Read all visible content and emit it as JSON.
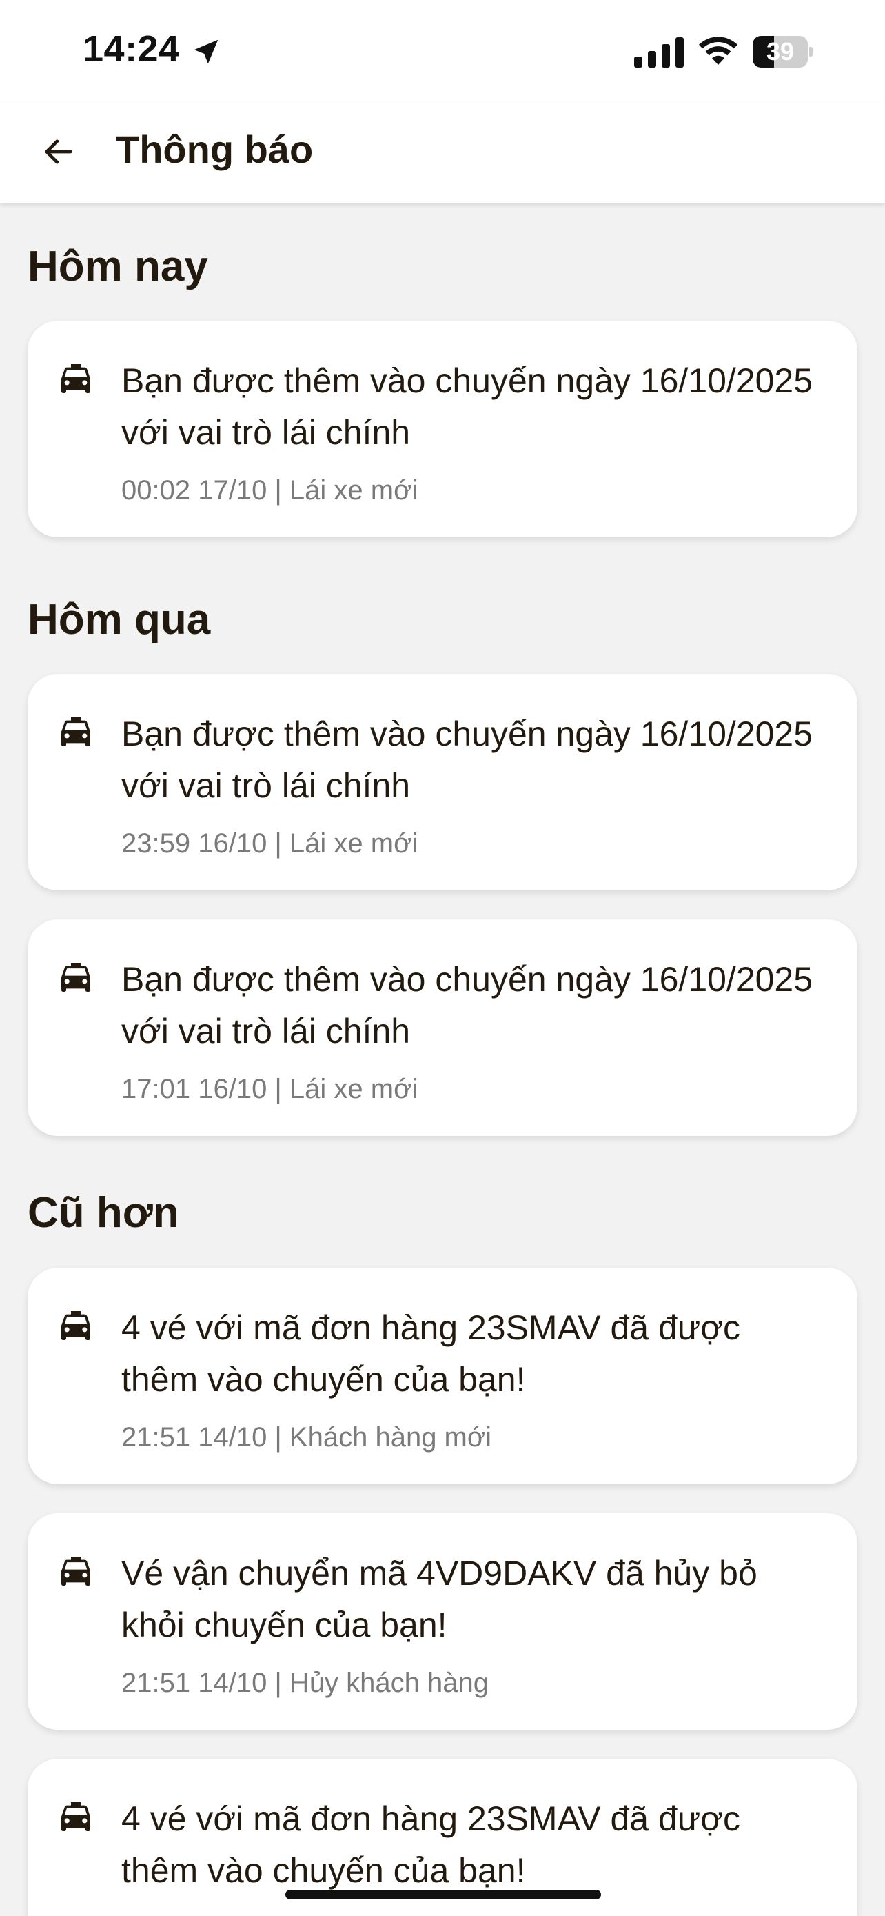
{
  "status_bar": {
    "time": "14:24",
    "battery_level": "39",
    "battery_percent": 39,
    "icons": [
      "location-arrow-icon",
      "cellular-signal-icon",
      "wifi-icon",
      "battery-icon"
    ]
  },
  "header": {
    "back_icon": "arrow-left-icon",
    "title": "Thông báo"
  },
  "colors": {
    "background": "#f2f2f2",
    "card": "#ffffff",
    "text_primary": "#231a0f",
    "text_secondary": "#7a7a7a"
  },
  "sections": [
    {
      "heading": "Hôm nay",
      "items": [
        {
          "icon": "car-icon",
          "title": "Bạn được thêm vào chuyến ngày 16/10/2025 với vai trò lái chính",
          "meta": "00:02 17/10 | Lái xe mới"
        }
      ]
    },
    {
      "heading": "Hôm qua",
      "items": [
        {
          "icon": "car-icon",
          "title": "Bạn được thêm vào chuyến ngày 16/10/2025 với vai trò lái chính",
          "meta": "23:59 16/10 | Lái xe mới"
        },
        {
          "icon": "car-icon",
          "title": "Bạn được thêm vào chuyến ngày 16/10/2025 với vai trò lái chính",
          "meta": "17:01 16/10 | Lái xe mới"
        }
      ]
    },
    {
      "heading": "Cũ hơn",
      "items": [
        {
          "icon": "car-icon",
          "title": "4 vé với mã đơn hàng 23SMAV đã được thêm vào chuyến của bạn!",
          "meta": "21:51 14/10 | Khách hàng mới"
        },
        {
          "icon": "car-icon",
          "title": "Vé vận chuyển mã 4VD9DAKV đã hủy bỏ khỏi chuyến của bạn!",
          "meta": "21:51 14/10 | Hủy khách hàng"
        },
        {
          "icon": "car-icon",
          "title": "4 vé với mã đơn hàng 23SMAV đã được thêm vào chuyến của bạn!",
          "meta": ""
        }
      ]
    }
  ]
}
